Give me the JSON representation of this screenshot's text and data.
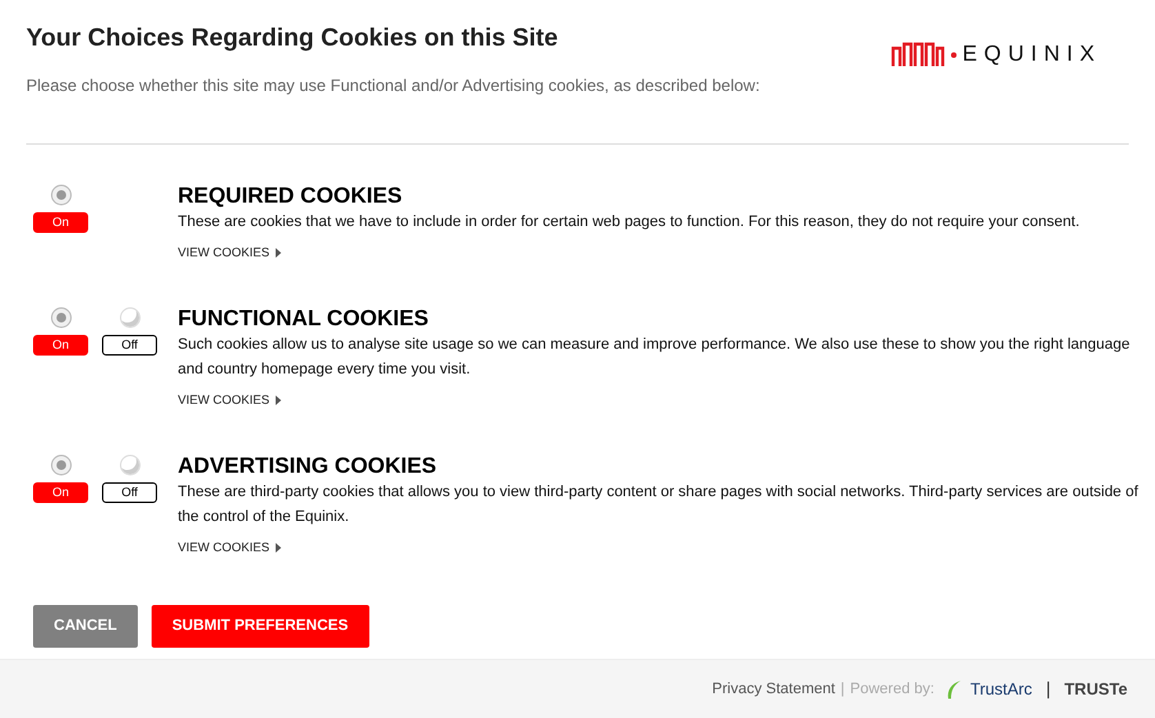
{
  "header": {
    "title": "Your Choices Regarding Cookies on this Site",
    "subtitle": "Please choose whether this site may use Functional and/or Advertising cookies, as described below:",
    "logo_text": "EQUINIX"
  },
  "categories": [
    {
      "title": "REQUIRED COOKIES",
      "description": "These are cookies that we have to include in order for certain web pages to function. For this reason, they do not require your consent.",
      "link": "VIEW COOKIES",
      "options": [
        {
          "label": "On",
          "selected": true
        }
      ]
    },
    {
      "title": "FUNCTIONAL COOKIES",
      "description": "Such cookies allow us to analyse site usage so we can measure and improve performance. We also use these to show you the right language and country homepage every time you visit.",
      "link": "VIEW COOKIES",
      "options": [
        {
          "label": "On",
          "selected": true
        },
        {
          "label": "Off",
          "selected": false
        }
      ]
    },
    {
      "title": "ADVERTISING COOKIES",
      "description": "These are third-party cookies that allows you to view third-party content or share pages with social networks. Third-party services are outside of the control of the Equinix.",
      "link": "VIEW COOKIES",
      "options": [
        {
          "label": "On",
          "selected": true
        },
        {
          "label": "Off",
          "selected": false
        }
      ]
    }
  ],
  "buttons": [
    {
      "label": "CANCEL",
      "kind": "secondary"
    },
    {
      "label": "SUBMIT PREFERENCES",
      "kind": "primary"
    }
  ],
  "footer": {
    "privacy": "Privacy Statement",
    "separator": "|",
    "powered": "Powered by:",
    "trustarc": "TrustArc",
    "divider": "|",
    "truste": "TRUSTe"
  }
}
